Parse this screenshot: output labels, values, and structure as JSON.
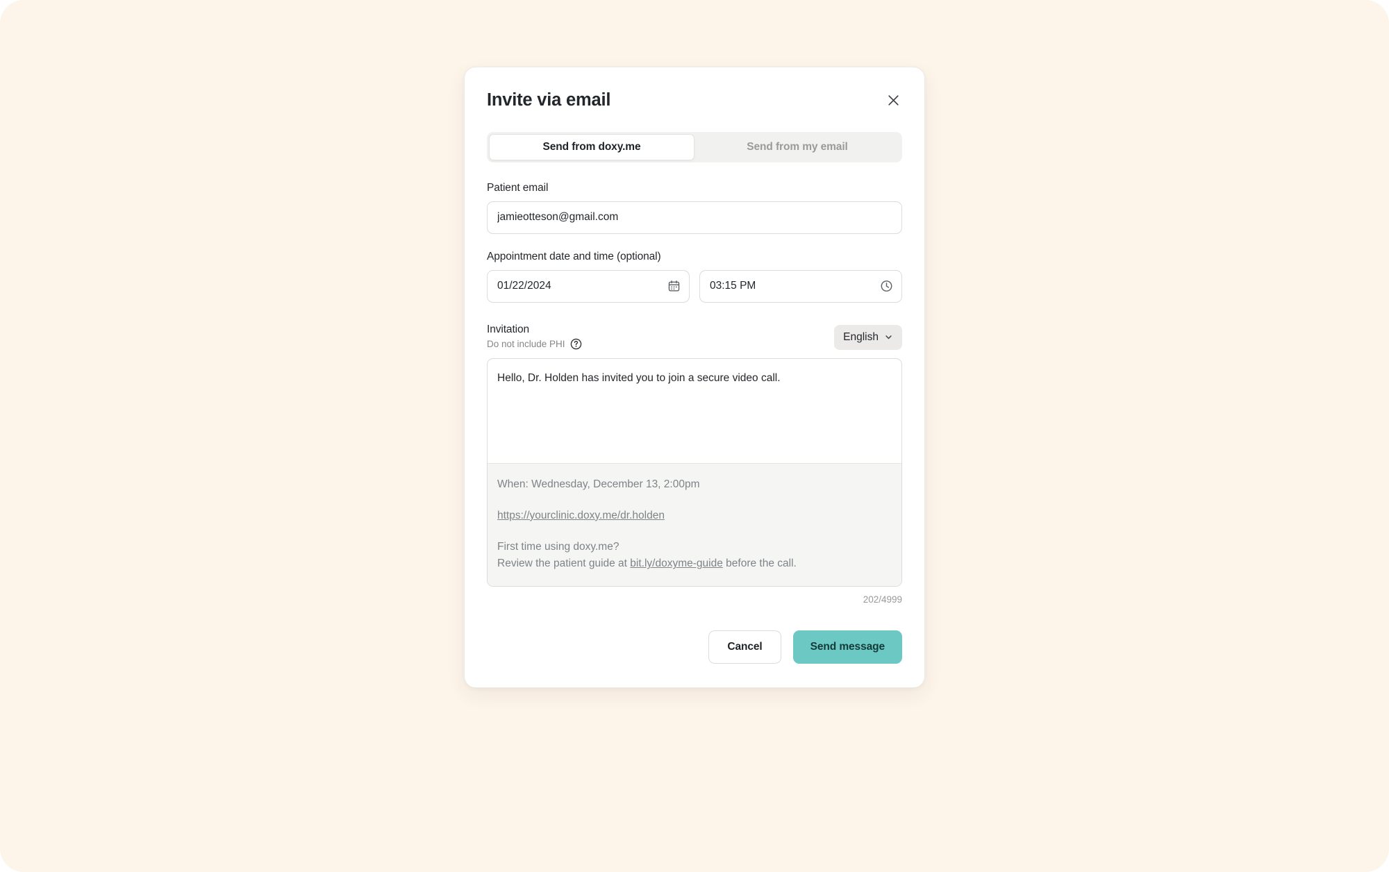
{
  "modal": {
    "title": "Invite via email",
    "close_icon": "close-icon",
    "tabs": [
      {
        "label": "Send from doxy.me",
        "active": true
      },
      {
        "label": "Send from my email",
        "active": false
      }
    ],
    "patient_email": {
      "label": "Patient email",
      "value": "jamieotteson@gmail.com",
      "placeholder": "Patient email"
    },
    "appointment": {
      "label": "Appointment date and time (optional)",
      "date_value": "01/22/2024",
      "date_placeholder": "MM/DD/YYYY",
      "date_icon": "calendar-icon",
      "time_value": "03:15 PM",
      "time_placeholder": "HH:MM AM/PM",
      "time_icon": "clock-icon"
    },
    "invitation": {
      "title": "Invitation",
      "subtitle": "Do not include PHI",
      "help_icon": "question-circle-icon",
      "language": "English",
      "language_chevron_icon": "chevron-down-icon",
      "message": "Hello, Dr. Holden has invited you to join a secure video call.",
      "preview": {
        "when": "When: Wednesday, December 13, 2:00pm",
        "room_link": "https://yourclinic.doxy.me/dr.holden",
        "footer_line1": "First time using doxy.me?",
        "footer_line2_before": "Review the patient guide at ",
        "footer_link": "bit.ly/doxyme-guide",
        "footer_line2_after": " before the call."
      },
      "char_count": "202/4999"
    },
    "footer": {
      "cancel_label": "Cancel",
      "send_label": "Send message"
    }
  },
  "colors": {
    "page_background": "#fdf4ea",
    "accent_teal": "#6cc8c3",
    "accent_teal_text": "#143b3a",
    "text_primary": "#23272b",
    "text_muted": "#7e8387",
    "border": "#dedcd8",
    "preview_background": "#f5f5f4",
    "segmented_track": "#f1f1ef"
  }
}
